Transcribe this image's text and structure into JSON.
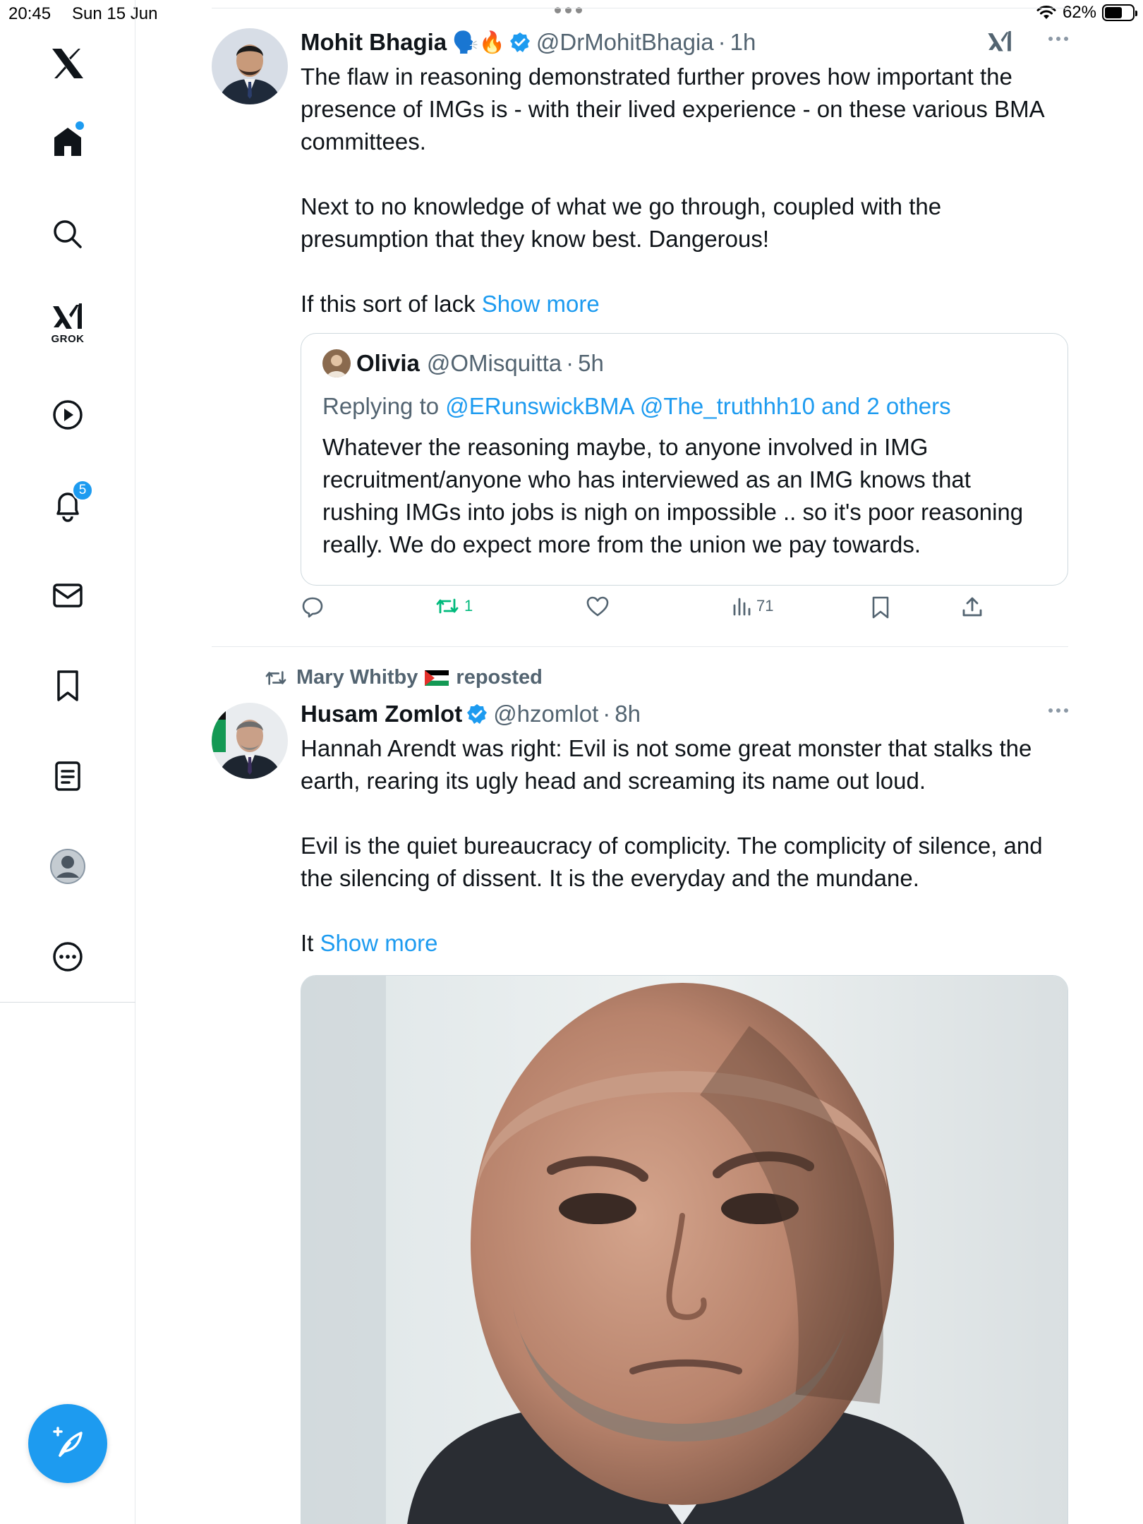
{
  "status_bar": {
    "time": "20:45",
    "date": "Sun 15 Jun",
    "battery_text": "62%",
    "battery_level": 0.62
  },
  "sidebar": {
    "grok_label": "GROK",
    "notifications_count": "5",
    "icons": [
      "x-logo-icon",
      "home-icon",
      "search-icon",
      "grok-icon",
      "video-icon",
      "bell-icon",
      "mail-icon",
      "bookmark-icon",
      "list-icon",
      "profile-icon",
      "more-icon",
      "compose-icon"
    ]
  },
  "feed": {
    "posts": [
      {
        "name": "Mohit Bhagia",
        "emojis": "🗣️🔥",
        "handle": "@DrMohitBhagia",
        "time": "1h",
        "paragraphs": [
          "The flaw in reasoning demonstrated further proves how important the presence of IMGs is - with their lived experience - on these various BMA committees.",
          "Next to no knowledge of what we go through, coupled with the presumption that they know best. Dangerous!"
        ],
        "truncated_text": "If this sort of lack",
        "show_more": "Show more",
        "quote": {
          "name": "Olivia",
          "handle": "@OMisquitta",
          "time": "5h",
          "replying_prefix": "Replying to",
          "replying_targets": "@ERunswickBMA @The_truthhh10 and 2 others",
          "text": "Whatever the reasoning maybe, to anyone involved in IMG recruitment/anyone who has interviewed as an IMG knows that rushing IMGs into jobs is nigh on impossible .. so it's poor reasoning really. We do expect more from the union we pay towards."
        },
        "actions": {
          "reposts": "1",
          "views": "71"
        }
      },
      {
        "reposted_by": "Mary Whitby",
        "reposted_label": "reposted",
        "name": "Husam Zomlot",
        "handle": "@hzomlot",
        "time": "8h",
        "paragraphs": [
          "Hannah Arendt was right: Evil is not some great monster that stalks the earth, rearing its ugly head and screaming its name out loud.",
          "Evil is the quiet bureaucracy of complicity. The complicity of silence, and the silencing of dissent. It is the everyday and the mundane."
        ],
        "truncated_text": "It",
        "show_more": "Show more"
      }
    ]
  },
  "colors": {
    "accent": "#1d9bf0",
    "retweet_green": "#00ba7c",
    "text_primary": "#0f1419",
    "text_secondary": "#536471"
  }
}
